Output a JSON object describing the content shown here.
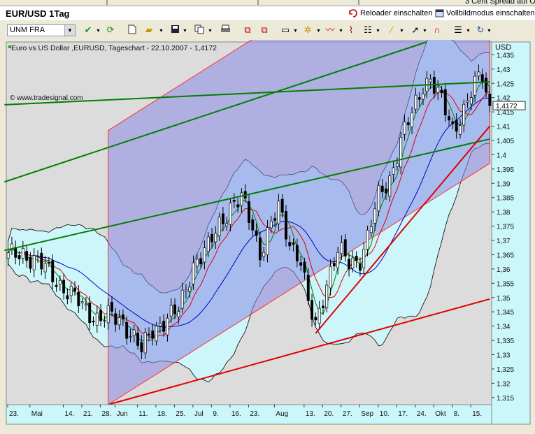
{
  "tab_partial": "3 Cent Spread auf O",
  "window": {
    "title": "EUR/USD 1Tag",
    "reload_label": "Reloader einschalten",
    "fullscreen_label": "Vollbildmodus einschalten"
  },
  "toolbar": {
    "combo_value": "UNM FRA",
    "icons": [
      "pin-icon",
      "refresh-icon",
      "new-doc-icon",
      "open-folder-icon",
      "save-icon",
      "copy-icon",
      "print-icon",
      "chart-edit-icon",
      "chart-add-icon",
      "window-icon",
      "indicator-icon",
      "trend-icon",
      "line-chart-icon",
      "settings-icon",
      "draw-line-icon",
      "cursor-icon",
      "magnet-icon",
      "template-icon",
      "undo-icon"
    ]
  },
  "chart_data": {
    "type": "candlestick",
    "title": "Euro vs US Dollar ,EURUSD, Tageschart - 22.10.2007 - 1,4172",
    "watermark": "© www.tradesignal.com",
    "y_unit": "USD",
    "current_price_label": "1,4172",
    "current_price": 1.4172,
    "ylim": [
      1.3125,
      1.4395
    ],
    "y_ticks": [
      1.315,
      1.32,
      1.325,
      1.33,
      1.335,
      1.34,
      1.345,
      1.35,
      1.355,
      1.36,
      1.365,
      1.37,
      1.375,
      1.38,
      1.385,
      1.39,
      1.395,
      1.4,
      1.405,
      1.41,
      1.415,
      1.42,
      1.425,
      1.43,
      1.435
    ],
    "y_tick_labels": [
      "1,315",
      "1,32",
      "1,325",
      "1,33",
      "1,335",
      "1,34",
      "1,345",
      "1,35",
      "1,355",
      "1,36",
      "1,365",
      "1,37",
      "1,375",
      "1,38",
      "1,385",
      "1,39",
      "1,395",
      "1,4",
      "1,405",
      "1,41",
      "1,415",
      "1,42",
      "1,425",
      "1,43",
      "1,435"
    ],
    "x_ticks": [
      {
        "label": "23.",
        "i": 0
      },
      {
        "label": "Mai",
        "i": 6
      },
      {
        "label": "14.",
        "i": 15
      },
      {
        "label": "21.",
        "i": 20
      },
      {
        "label": "28.",
        "i": 25
      },
      {
        "label": "Jun",
        "i": 29
      },
      {
        "label": "11.",
        "i": 35
      },
      {
        "label": "18.",
        "i": 40
      },
      {
        "label": "25.",
        "i": 45
      },
      {
        "label": "Jul",
        "i": 50
      },
      {
        "label": "9.",
        "i": 55
      },
      {
        "label": "16.",
        "i": 60
      },
      {
        "label": "23.",
        "i": 65
      },
      {
        "label": "Aug",
        "i": 72
      },
      {
        "label": "13.",
        "i": 80
      },
      {
        "label": "20.",
        "i": 85
      },
      {
        "label": "27.",
        "i": 90
      },
      {
        "label": "Sep",
        "i": 95
      },
      {
        "label": "10.",
        "i": 100
      },
      {
        "label": "17.",
        "i": 105
      },
      {
        "label": "24.",
        "i": 110
      },
      {
        "label": "Okt",
        "i": 115
      },
      {
        "label": "8.",
        "i": 120
      },
      {
        "label": "15.",
        "i": 125
      }
    ],
    "bar_count": 131,
    "close_anchors": [
      [
        0,
        1.364
      ],
      [
        4,
        1.366
      ],
      [
        8,
        1.362
      ],
      [
        12,
        1.358
      ],
      [
        16,
        1.352
      ],
      [
        20,
        1.347
      ],
      [
        24,
        1.343
      ],
      [
        28,
        1.343
      ],
      [
        31,
        1.342
      ],
      [
        34,
        1.336
      ],
      [
        36,
        1.331
      ],
      [
        39,
        1.339
      ],
      [
        42,
        1.342
      ],
      [
        46,
        1.345
      ],
      [
        50,
        1.362
      ],
      [
        54,
        1.367
      ],
      [
        57,
        1.376
      ],
      [
        60,
        1.382
      ],
      [
        63,
        1.384
      ],
      [
        66,
        1.375
      ],
      [
        68,
        1.366
      ],
      [
        70,
        1.372
      ],
      [
        73,
        1.381
      ],
      [
        76,
        1.37
      ],
      [
        79,
        1.363
      ],
      [
        81,
        1.347
      ],
      [
        83,
        1.34
      ],
      [
        86,
        1.356
      ],
      [
        89,
        1.366
      ],
      [
        92,
        1.362
      ],
      [
        95,
        1.364
      ],
      [
        97,
        1.371
      ],
      [
        100,
        1.385
      ],
      [
        103,
        1.392
      ],
      [
        106,
        1.405
      ],
      [
        109,
        1.414
      ],
      [
        112,
        1.425
      ],
      [
        114,
        1.427
      ],
      [
        117,
        1.418
      ],
      [
        120,
        1.409
      ],
      [
        123,
        1.416
      ],
      [
        126,
        1.424
      ],
      [
        128,
        1.428
      ],
      [
        130,
        1.4172
      ]
    ],
    "channel": {
      "bar0": [
        27,
        1.3125
      ],
      "bar1": [
        130,
        1.397
      ],
      "width": 0.096
    },
    "lines": [
      {
        "name": "green-trend-1",
        "color": "#007f00",
        "p0": [
          -1,
          1.3905
        ],
        "p1": [
          113,
          1.4395
        ]
      },
      {
        "name": "green-trend-2",
        "color": "#007f00",
        "p0": [
          -1,
          1.4175
        ],
        "p1": [
          130,
          1.4255
        ]
      },
      {
        "name": "green-trend-3",
        "color": "#007f00",
        "p0": [
          -1,
          1.3665
        ],
        "p1": [
          130,
          1.4055
        ]
      },
      {
        "name": "red-trend-1",
        "color": "#e00000",
        "p0": [
          27,
          1.3125
        ],
        "p1": [
          130,
          1.3495
        ]
      },
      {
        "name": "red-trend-2",
        "color": "#e00000",
        "p0": [
          83,
          1.3375
        ],
        "p1": [
          130,
          1.41
        ]
      }
    ],
    "colors": {
      "background": "#dcdcdc",
      "band_fill": "#cdf6fa",
      "channel_fill": "#8a8ae6",
      "up": "#ffffff",
      "down": "#000000",
      "grid": "#b8b8b8",
      "ma_fast": "#007f00",
      "ma_mid": "#e00000",
      "ma_slow": "#0000c8"
    }
  }
}
